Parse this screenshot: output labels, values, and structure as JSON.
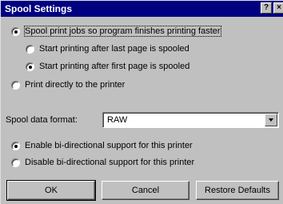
{
  "window": {
    "title": "Spool Settings",
    "help_glyph": "?",
    "close_glyph": "×"
  },
  "spooling": {
    "spool_option": "Spool print jobs so program finishes printing faster",
    "after_last": "Start printing after last page is spooled",
    "after_first": "Start printing after first page is spooled",
    "print_direct": "Print directly to the printer",
    "selected_mode": "spool",
    "selected_start": "after_first"
  },
  "format": {
    "label": "Spool data format:",
    "value": "RAW"
  },
  "bidi": {
    "enable": "Enable bi-directional support for this printer",
    "disable": "Disable bi-directional support for this printer",
    "selected": "enable"
  },
  "buttons": {
    "ok": "OK",
    "cancel": "Cancel",
    "restore": "Restore Defaults"
  }
}
